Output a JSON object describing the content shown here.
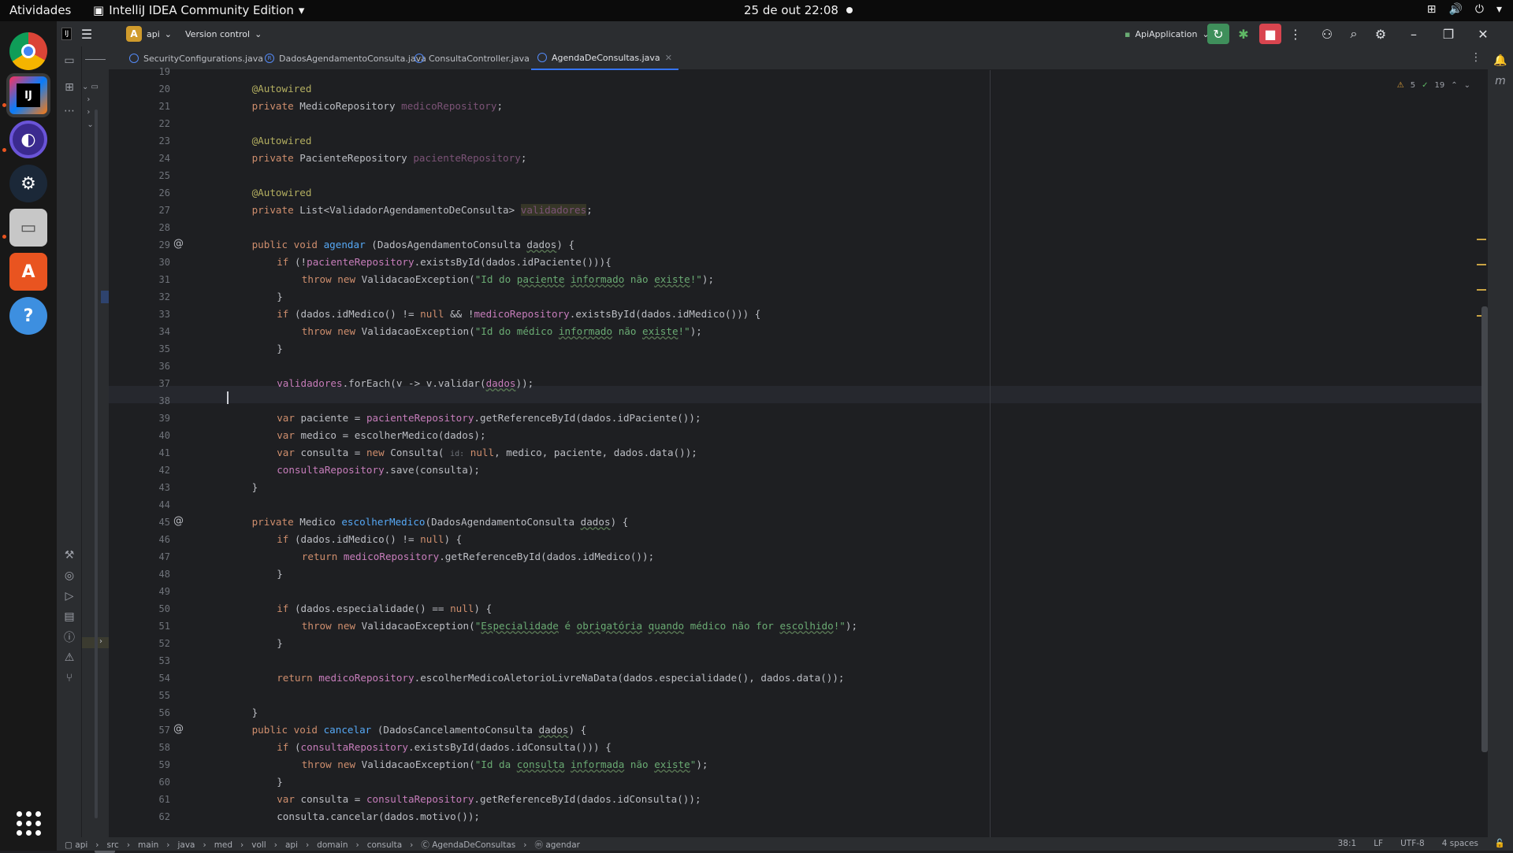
{
  "topbar": {
    "activities": "Atividades",
    "app_name": "IntelliJ IDEA Community Edition",
    "clock": "25 de out  22:08"
  },
  "dock": {
    "items": [
      "chrome-icon",
      "intellij-icon",
      "eclipse-icon",
      "steam-icon",
      "files-icon",
      "app-center-icon",
      "help-icon"
    ],
    "apps_grid": "show-apps-icon"
  },
  "ide": {
    "project": {
      "badge": "A",
      "name": "api"
    },
    "vcs": "Version control",
    "run_config": "ApiApplication",
    "tabs": [
      {
        "label": "SecurityConfigurations.java"
      },
      {
        "label": "DadosAgendamentoConsulta.java"
      },
      {
        "label": "ConsultaController.java"
      },
      {
        "label": "AgendaDeConsultas.java"
      }
    ],
    "inspections": {
      "warnings": "5",
      "ok": "19"
    },
    "line_numbers": [
      "19",
      "20",
      "21",
      "22",
      "23",
      "24",
      "25",
      "26",
      "27",
      "28",
      "29",
      "30",
      "31",
      "32",
      "33",
      "34",
      "35",
      "36",
      "37",
      "38",
      "39",
      "40",
      "41",
      "42",
      "43",
      "44",
      "45",
      "46",
      "47",
      "48",
      "49",
      "50",
      "51",
      "52",
      "53",
      "54",
      "55",
      "56",
      "57",
      "58",
      "59",
      "60",
      "61",
      "62"
    ],
    "status": {
      "breadcrumbs": [
        "api",
        "src",
        "main",
        "java",
        "med",
        "voll",
        "api",
        "domain",
        "consulta",
        "AgendaDeConsultas",
        "agendar"
      ],
      "position": "38:1",
      "line_sep": "LF",
      "encoding": "UTF-8",
      "indent": "4 spaces"
    }
  }
}
